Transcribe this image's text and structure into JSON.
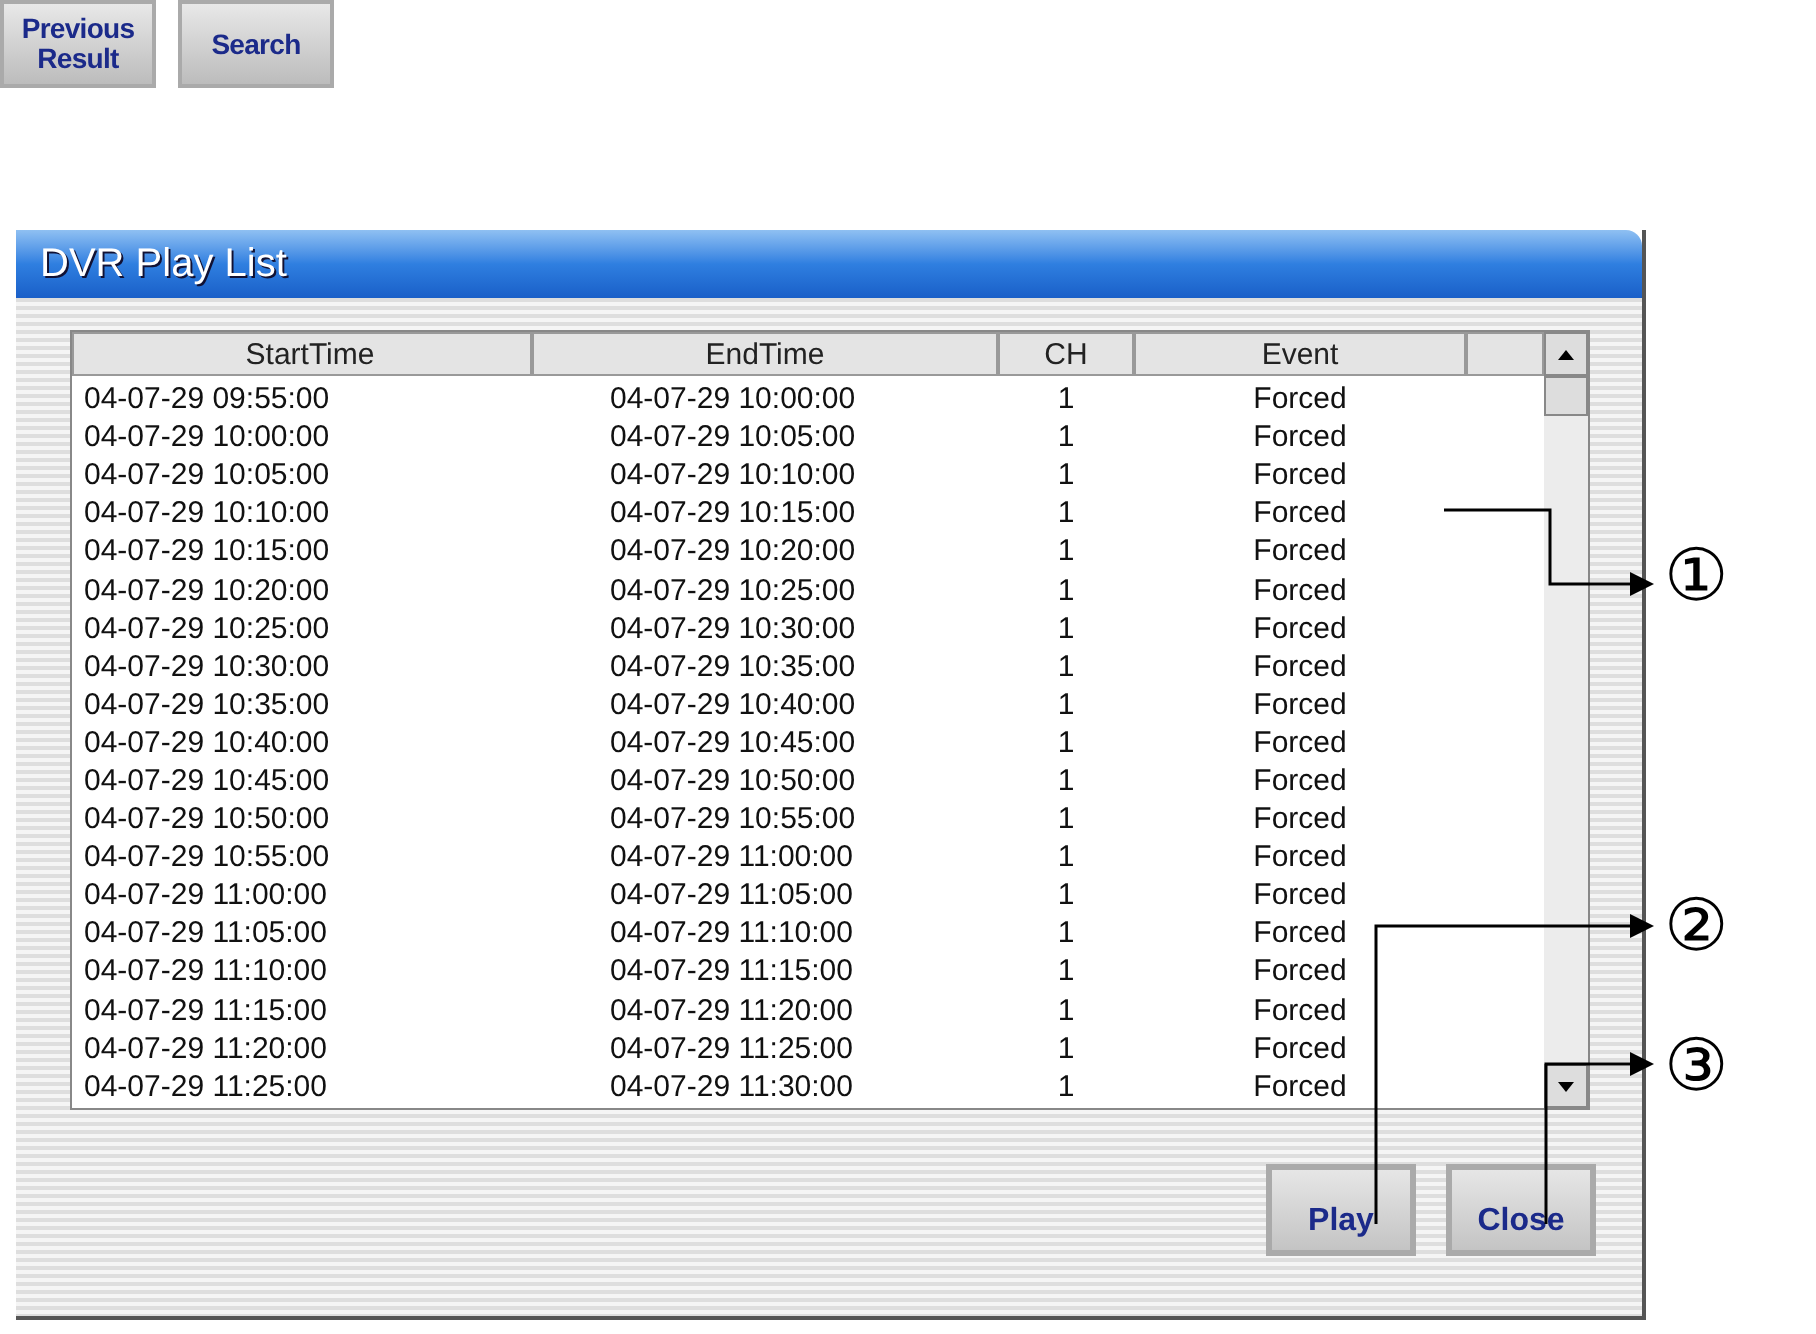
{
  "top_buttons": [
    {
      "label": "Previous\nResult"
    },
    {
      "label": "Search"
    }
  ],
  "window": {
    "title": "DVR Play List"
  },
  "table": {
    "columns": [
      "StartTime",
      "EndTime",
      "CH",
      "Event"
    ],
    "rows": [
      [
        "04-07-29 09:55:00",
        "04-07-29 10:00:00",
        "1",
        "Forced"
      ],
      [
        "04-07-29 10:00:00",
        "04-07-29 10:05:00",
        "1",
        "Forced"
      ],
      [
        "04-07-29 10:05:00",
        "04-07-29 10:10:00",
        "1",
        "Forced"
      ],
      [
        "04-07-29 10:10:00",
        "04-07-29 10:15:00",
        "1",
        "Forced"
      ],
      [
        "04-07-29 10:15:00",
        "04-07-29 10:20:00",
        "1",
        "Forced"
      ],
      [
        "04-07-29 10:20:00",
        "04-07-29 10:25:00",
        "1",
        "Forced"
      ],
      [
        "04-07-29 10:25:00",
        "04-07-29 10:30:00",
        "1",
        "Forced"
      ],
      [
        "04-07-29 10:30:00",
        "04-07-29 10:35:00",
        "1",
        "Forced"
      ],
      [
        "04-07-29 10:35:00",
        "04-07-29 10:40:00",
        "1",
        "Forced"
      ],
      [
        "04-07-29 10:40:00",
        "04-07-29 10:45:00",
        "1",
        "Forced"
      ],
      [
        "04-07-29 10:45:00",
        "04-07-29 10:50:00",
        "1",
        "Forced"
      ],
      [
        "04-07-29 10:50:00",
        "04-07-29 10:55:00",
        "1",
        "Forced"
      ],
      [
        "04-07-29 10:55:00",
        "04-07-29 11:00:00",
        "1",
        "Forced"
      ],
      [
        "04-07-29 11:00:00",
        "04-07-29 11:05:00",
        "1",
        "Forced"
      ],
      [
        "04-07-29 11:05:00",
        "04-07-29 11:10:00",
        "1",
        "Forced"
      ],
      [
        "04-07-29 11:10:00",
        "04-07-29 11:15:00",
        "1",
        "Forced"
      ],
      [
        "04-07-29 11:15:00",
        "04-07-29 11:20:00",
        "1",
        "Forced"
      ],
      [
        "04-07-29 11:20:00",
        "04-07-29 11:25:00",
        "1",
        "Forced"
      ],
      [
        "04-07-29 11:25:00",
        "04-07-29 11:30:00",
        "1",
        "Forced"
      ]
    ]
  },
  "buttons": [
    "Play",
    "Close"
  ],
  "callouts": [
    "①",
    "②",
    "③"
  ]
}
